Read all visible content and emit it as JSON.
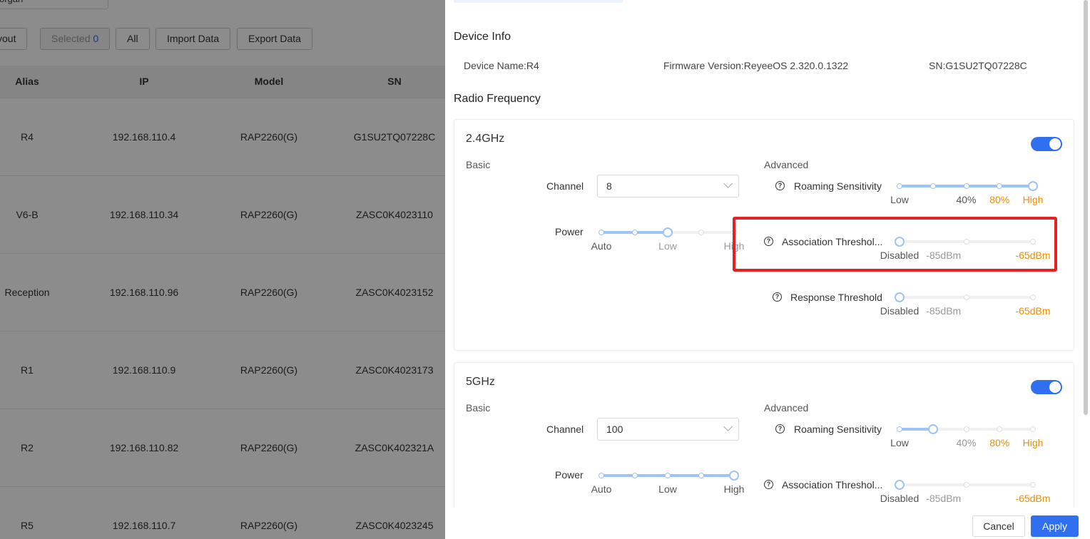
{
  "background": {
    "search_value": "organ",
    "buttons": {
      "layout": "yout",
      "selected_label": "Selected",
      "selected_count": "0",
      "all": "All",
      "import": "Import Data",
      "export": "Export Data"
    },
    "columns": {
      "alias": "Alias",
      "ip": "IP",
      "model": "Model",
      "sn": "SN"
    },
    "rows": [
      {
        "alias": "R4",
        "ip": "192.168.110.4",
        "model": "RAP2260(G)",
        "sn": "G1SU2TQ07228C"
      },
      {
        "alias": "V6-B",
        "ip": "192.168.110.34",
        "model": "RAP2260(G)",
        "sn": "ZASC0K4023110"
      },
      {
        "alias": "Reception",
        "ip": "192.168.110.96",
        "model": "RAP2260(G)",
        "sn": "ZASC0K4023152"
      },
      {
        "alias": "R1",
        "ip": "192.168.110.9",
        "model": "RAP2260(G)",
        "sn": "ZASC0K4023173"
      },
      {
        "alias": "R2",
        "ip": "192.168.110.82",
        "model": "RAP2260(G)",
        "sn": "ZASC0K402321A"
      },
      {
        "alias": "R5",
        "ip": "192.168.110.7",
        "model": "RAP2260(G)",
        "sn": "ZASC0K4023245"
      }
    ]
  },
  "drawer": {
    "device_info": {
      "title": "Device Info",
      "device_name": "Device Name:R4",
      "firmware": "Firmware Version:ReyeeOS 2.320.0.1322",
      "sn": "SN:G1SU2TQ07228C"
    },
    "radio_title": "Radio Frequency",
    "band24": {
      "title": "2.4GHz",
      "enabled": true,
      "basic": "Basic",
      "advanced": "Advanced",
      "channel_label": "Channel",
      "channel_value": "8",
      "power_label": "Power",
      "power_marks": [
        "Auto",
        "Low",
        "High"
      ],
      "power_level": 2,
      "roaming_label": "Roaming Sensitivity",
      "roaming_marks": [
        "Low",
        "40%",
        "80%",
        "High"
      ],
      "roaming_level": 4,
      "assoc_label": "Association Threshol...",
      "assoc_marks": [
        "Disabled",
        "-85dBm",
        "-65dBm"
      ],
      "response_label": "Response Threshold",
      "response_marks": [
        "Disabled",
        "-85dBm",
        "-65dBm"
      ]
    },
    "band5": {
      "title": "5GHz",
      "enabled": true,
      "basic": "Basic",
      "advanced": "Advanced",
      "channel_label": "Channel",
      "channel_value": "100",
      "power_label": "Power",
      "power_marks": [
        "Auto",
        "Low",
        "High"
      ],
      "power_level": 4,
      "roaming_label": "Roaming Sensitivity",
      "roaming_marks": [
        "Low",
        "40%",
        "80%",
        "High"
      ],
      "roaming_level": 1,
      "assoc_label": "Association Threshol...",
      "assoc_marks": [
        "Disabled",
        "-85dBm",
        "-65dBm"
      ]
    },
    "footer": {
      "cancel": "Cancel",
      "apply": "Apply"
    },
    "colors": {
      "primary": "#2f6ff0",
      "slider_track": "#9fc2f7",
      "highlight": "#e62121",
      "orange": "#f08c00"
    },
    "help_icon": "question-circle-icon"
  }
}
